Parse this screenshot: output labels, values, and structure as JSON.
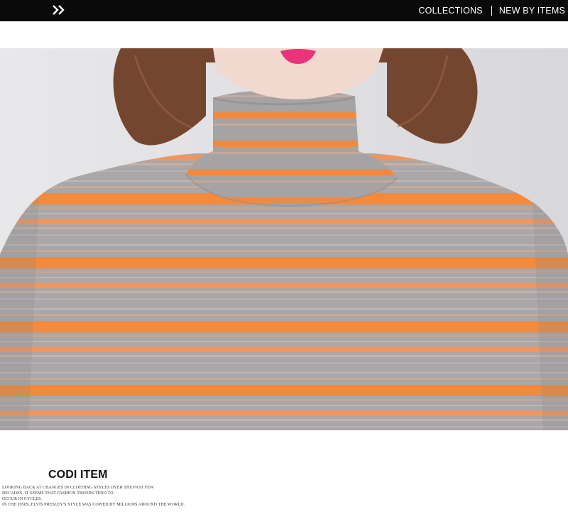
{
  "header": {
    "logo_icon": "double-chevron-right-icon",
    "nav": [
      {
        "label": "COLLECTIONS"
      },
      {
        "label": "NEW BY ITEMS"
      }
    ]
  },
  "photo": {
    "subject": "striped-turtleneck-sweater",
    "colors": {
      "gray": "#a8a6a6",
      "orange": "#f58a3a",
      "hair": "#7a4a33",
      "background": "#e6e6e8"
    }
  },
  "codi": {
    "title": "CODI ITEM",
    "lines": [
      "LOOKING BACK AT CHANGES IN CLOTHING STYLES OVER THE PAST FEW",
      "DECADES, IT SEEMS THAT FASHION TRENDS TEND TO",
      "OCCUR IN CYCLES.",
      "IN THE 1950S, ELVIS PRESLEY'S STYLE WAS COPIED BY MILLIONS AROUND THE WORLD."
    ]
  }
}
